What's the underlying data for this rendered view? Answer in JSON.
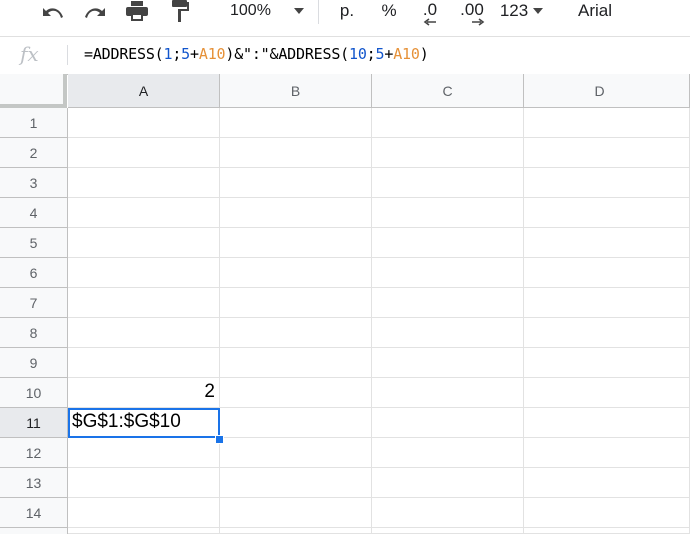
{
  "toolbar": {
    "undo_icon": "undo-icon",
    "redo_icon": "redo-icon",
    "print_icon": "print-icon",
    "paint_format_icon": "paint-format-icon",
    "zoom": "100%",
    "currency": "p.",
    "percent": "%",
    "decrease_decimals": ".0",
    "increase_decimals": ".00",
    "more_formats": "123",
    "font": "Arial"
  },
  "formula_bar": {
    "fx": "fx",
    "formula_parts": [
      "=ADDRESS(",
      "1",
      ";",
      "5",
      "+",
      "A10",
      ")&\":\"&ADDRESS(",
      "10",
      ";",
      "5",
      "+",
      "A10",
      ")"
    ]
  },
  "columns": [
    "A",
    "B",
    "C",
    "D"
  ],
  "rows": [
    "1",
    "2",
    "3",
    "4",
    "5",
    "6",
    "7",
    "8",
    "9",
    "10",
    "11",
    "12",
    "13",
    "14"
  ],
  "cells": {
    "A10": "2",
    "A11": "$G$1:$G$10"
  },
  "colors": {
    "selection": "#1a73e8",
    "ref_blue": "#1155cc",
    "ref_orange": "#e69138"
  }
}
